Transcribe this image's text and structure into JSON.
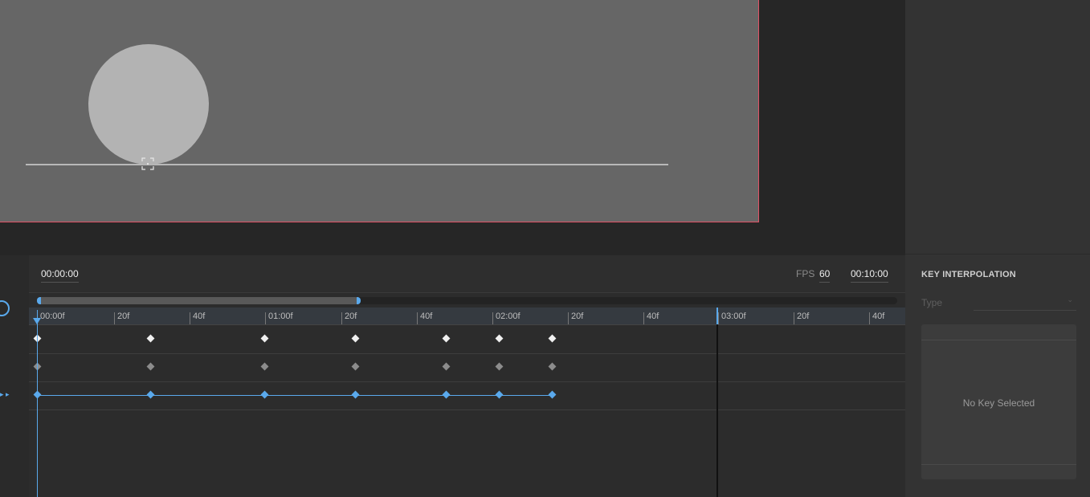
{
  "timeline": {
    "current_time": "00:00:00",
    "fps_label": "FPS",
    "fps_value": "60",
    "end_time": "00:10:00",
    "ruler_labels": [
      "00:00f",
      "20f",
      "40f",
      "01:00f",
      "20f",
      "40f",
      "02:00f",
      "20f",
      "40f",
      "03:00f",
      "20f",
      "40f"
    ],
    "scroll_visible_fraction": 0.37,
    "tracks": [
      {
        "style": "white"
      },
      {
        "style": "gray"
      },
      {
        "style": "blue"
      }
    ]
  },
  "panel": {
    "title": "KEY INTERPOLATION",
    "type_label": "Type",
    "type_value": "",
    "empty_message": "No Key Selected"
  },
  "colors": {
    "accent": "#5aa9ec",
    "canvas_border": "#e05266",
    "canvas_bg": "#666666",
    "ball": "#b3b3b3"
  },
  "icons": {
    "anchor": "transform-anchor-icon",
    "playhead": "playhead-icon",
    "chevron": "chevron-down-icon"
  }
}
